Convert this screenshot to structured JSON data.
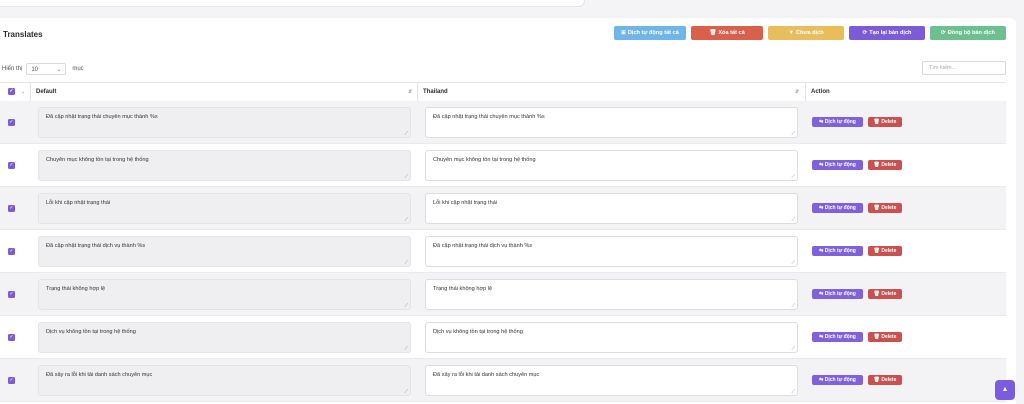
{
  "card": {
    "title": "Translates"
  },
  "actions": [
    {
      "label": "Dịch tự động tất cả",
      "icon": "translate-icon",
      "glyph": "⊞",
      "color": "#6fb5e8",
      "width": 72
    },
    {
      "label": "Xóa tất cả",
      "icon": "trash-icon",
      "glyph": "🗑",
      "color": "#d9614b",
      "width": 72
    },
    {
      "label": "Chưa dịch",
      "icon": "filter-icon",
      "glyph": "▼",
      "color": "#e8bd5b",
      "width": 76
    },
    {
      "label": "Tạo lại bản dịch",
      "icon": "refresh-icon",
      "glyph": "⟳",
      "color": "#7c5cd6",
      "width": 76
    },
    {
      "label": "Đồng bộ bản dịch",
      "icon": "sync-icon",
      "glyph": "⟳",
      "color": "#6cc08f",
      "width": 76
    }
  ],
  "show": {
    "prefix": "Hiển thị",
    "value": "10",
    "suffix": "mục"
  },
  "search": {
    "placeholder": "Tìm kiếm..."
  },
  "columns": {
    "default": "Default",
    "thailand": "Thailand",
    "action": "Action"
  },
  "row_buttons": {
    "translate": "Dịch tự động",
    "delete": "Delete"
  },
  "rows": [
    {
      "default": "Đã cập nhật trạng thái chuyên mục thành %s",
      "thai": "Đã cập nhật trạng thái chuyên mục thành %s"
    },
    {
      "default": "Chuyên mục không tồn tại trong hệ thống",
      "thai": "Chuyên mục không tồn tại trong hệ thống"
    },
    {
      "default": "Lỗi khi cập nhật trạng thái",
      "thai": "Lỗi khi cập nhật trạng thái"
    },
    {
      "default": "Đã cập nhật trạng thái dịch vụ thành %s",
      "thai": "Đã cập nhật trạng thái dịch vụ thành %s"
    },
    {
      "default": "Trạng thái không hợp lệ",
      "thai": "Trạng thái không hợp lệ"
    },
    {
      "default": "Dịch vụ không tồn tại trong hệ thống",
      "thai": "Dịch vụ không tồn tại trong hệ thống"
    },
    {
      "default": "Đã xảy ra lỗi khi tải danh sách chuyên mục",
      "thai": "Đã xảy ra lỗi khi tải danh sách chuyên mục"
    }
  ]
}
